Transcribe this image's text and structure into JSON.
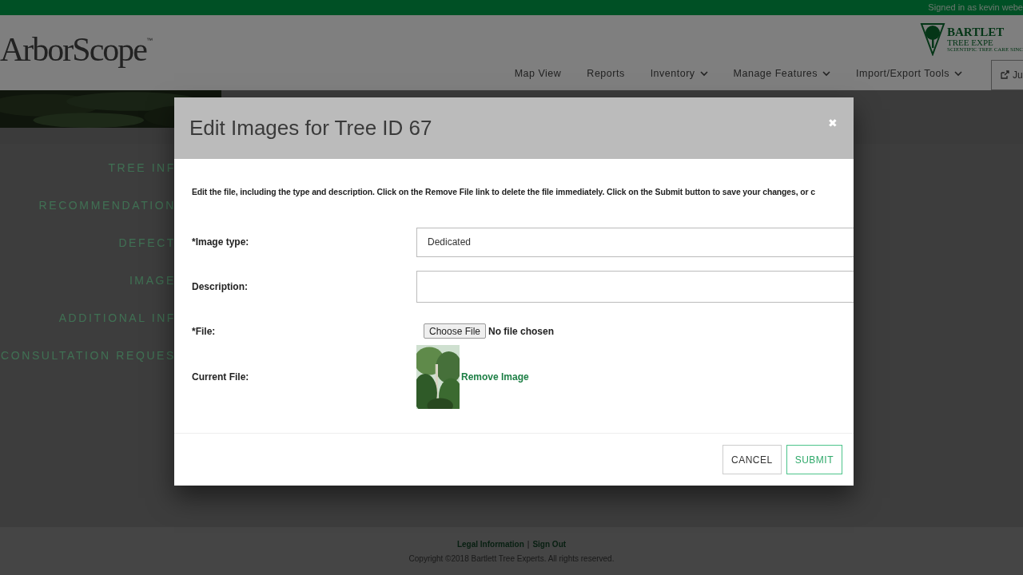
{
  "top_bar": {
    "signed_in": "Signed in as kevin webe"
  },
  "header": {
    "logo": "ArborScope",
    "logo_mark": "™",
    "partner_logo": [
      "BARTLET",
      "TREE EXPE",
      "SCIENTIFIC TREE CARE SINC"
    ],
    "nav": [
      {
        "label": "Map View",
        "dropdown": false
      },
      {
        "label": "Reports",
        "dropdown": false
      },
      {
        "label": "Inventory",
        "dropdown": true
      },
      {
        "label": "Manage Features",
        "dropdown": true
      },
      {
        "label": "Import/Export Tools",
        "dropdown": true
      }
    ],
    "action_button": "Ju"
  },
  "sidebar": {
    "items": [
      "TREE INF",
      "RECOMMENDATION",
      "DEFECT",
      "IMAGE",
      "ADDITIONAL INF",
      "CONSULTATION REQUES"
    ]
  },
  "dialog": {
    "title": "Edit Images for Tree ID 67",
    "close": "✖",
    "intro": "Edit the file, including the type and description. Click on the Remove File link to delete the file immediately. Click on the Submit button to save your changes, or c",
    "fields": [
      {
        "kind": "select",
        "label": "*Image type:",
        "value": "Dedicated"
      },
      {
        "kind": "text",
        "label": "Description:"
      },
      {
        "kind": "file",
        "label": "*File:",
        "button": "Choose File",
        "status": "No file chosen"
      },
      {
        "kind": "current",
        "label": "Current File:",
        "link": "Remove Image"
      }
    ],
    "buttons": [
      {
        "label": "CANCEL",
        "kind": "secondary"
      },
      {
        "label": "SUBMIT",
        "kind": "primary"
      }
    ]
  },
  "footer": {
    "links": [
      "Legal Information",
      "Sign Out"
    ],
    "separator": "|",
    "copyright": "Copyright ©2018 Bartlett Tree Experts. All rights reserved."
  }
}
